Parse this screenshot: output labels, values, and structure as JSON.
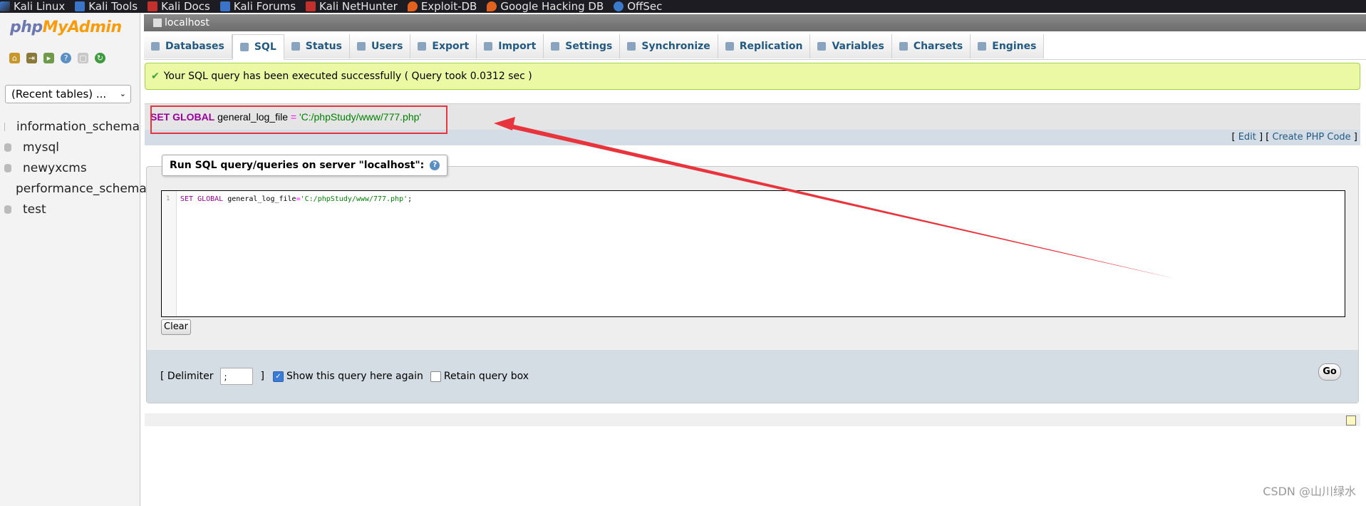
{
  "bookmarks": [
    {
      "label": "Kali Linux",
      "icon": "kali-icon"
    },
    {
      "label": "Kali Tools",
      "icon": "kali-tools-icon"
    },
    {
      "label": "Kali Docs",
      "icon": "kali-docs-icon"
    },
    {
      "label": "Kali Forums",
      "icon": "kali-forums-icon"
    },
    {
      "label": "Kali NetHunter",
      "icon": "nethunter-icon"
    },
    {
      "label": "Exploit-DB",
      "icon": "exploitdb-icon"
    },
    {
      "label": "Google Hacking DB",
      "icon": "ghdb-icon"
    },
    {
      "label": "OffSec",
      "icon": "offsec-icon"
    }
  ],
  "logo": {
    "php": "php",
    "myadmin": "MyAdmin"
  },
  "nav": {
    "recent_tables": "(Recent tables) ...",
    "databases": [
      "information_schema",
      "mysql",
      "newyxcms",
      "performance_schema",
      "test"
    ]
  },
  "server": {
    "name": "localhost"
  },
  "tabs": [
    {
      "label": "Databases",
      "active": false
    },
    {
      "label": "SQL",
      "active": true
    },
    {
      "label": "Status",
      "active": false
    },
    {
      "label": "Users",
      "active": false
    },
    {
      "label": "Export",
      "active": false
    },
    {
      "label": "Import",
      "active": false
    },
    {
      "label": "Settings",
      "active": false
    },
    {
      "label": "Synchronize",
      "active": false
    },
    {
      "label": "Replication",
      "active": false
    },
    {
      "label": "Variables",
      "active": false
    },
    {
      "label": "Charsets",
      "active": false
    },
    {
      "label": "Engines",
      "active": false
    }
  ],
  "success_message": "Your SQL query has been executed successfully ( Query took 0.0312 sec )",
  "executed_sql": {
    "kw_set": "SET",
    "kw_global": "GLOBAL",
    "name": "general_log_file",
    "op": "=",
    "value": "'C:/phpStudy/www/777.php'"
  },
  "links": {
    "edit": "Edit",
    "create_php": "Create PHP Code"
  },
  "query_box": {
    "legend": "Run SQL query/queries on server \"localhost\":",
    "line_number": "1",
    "code_kw": "SET GLOBAL",
    "code_name": "general_log_file",
    "code_op": "=",
    "code_str": "'C:/phpStudy/www/777.php'",
    "code_end": ";",
    "clear_label": "Clear"
  },
  "options": {
    "delimiter_label": "[ Delimiter",
    "delimiter_value": ";",
    "close_bracket": "]",
    "show_query_label": "Show this query here again",
    "show_query_checked": true,
    "retain_label": "Retain query box",
    "retain_checked": false,
    "go_label": "Go"
  },
  "watermark": "CSDN @山川绿水",
  "colors": {
    "annotation_red": "#e8343c",
    "success_bg": "#ebf8a4",
    "link": "#235a81"
  }
}
